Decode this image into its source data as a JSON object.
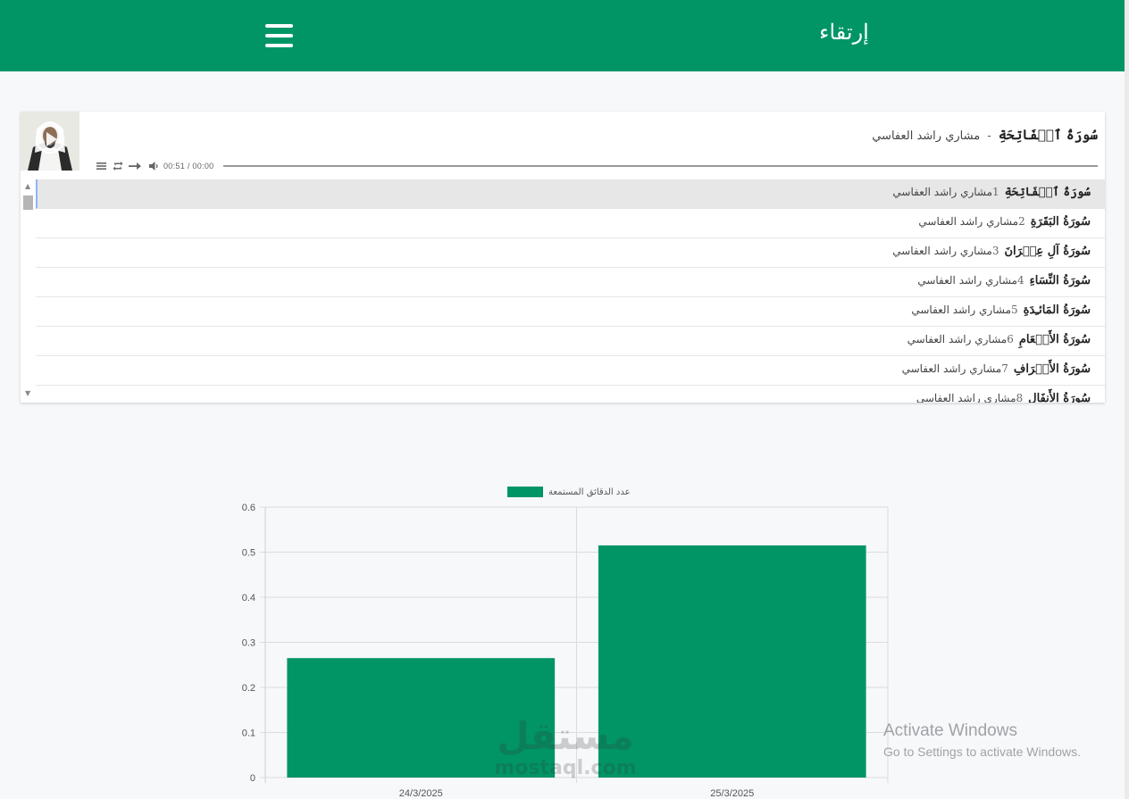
{
  "navbar": {
    "brand": "إرتقاء",
    "menu_icon": "hamburger-menu-icon",
    "background": "#019566"
  },
  "player": {
    "poster_icon": "play-circle-icon",
    "now_playing_title": "سُورَةُ ٱلۡفَاتِحَةِ",
    "now_playing_separator": "-",
    "now_playing_artist": "مشاري راشد العفاسي",
    "controls": [
      "playlist-icon",
      "repeat-icon",
      "next-arrow-icon",
      "volume-icon"
    ],
    "time": "00:51 / 00:00"
  },
  "playlist": [
    {
      "num": "1",
      "title": "سُورَةُ ٱلۡفَاتِحَةِ",
      "artist": "مشاري راشد العفاسي",
      "active": true
    },
    {
      "num": "2",
      "title": "سُورَةُ البَقَرَةِ",
      "artist": "مشاري راشد العفاسي"
    },
    {
      "num": "3",
      "title": "سُورَةُ آلِ عِمۡرَانَ",
      "artist": "مشاري راشد العفاسي"
    },
    {
      "num": "4",
      "title": "سُورَةُ النِّسَاءِ",
      "artist": "مشاري راشد العفاسي"
    },
    {
      "num": "5",
      "title": "سُورَةُ المَائـِدَةِ",
      "artist": "مشاري راشد العفاسي"
    },
    {
      "num": "6",
      "title": "سُورَةُ الأَنۡعَامِ",
      "artist": "مشاري راشد العفاسي"
    },
    {
      "num": "7",
      "title": "سُورَةُ الأَعۡرَافِ",
      "artist": "مشاري راشد العفاسي"
    },
    {
      "num": "8",
      "title": "سُورَةُ الأَنفَالِ",
      "artist": "مشاري راشد العفاسي"
    }
  ],
  "chart_data": {
    "type": "bar",
    "categories": [
      "24/3/2025",
      "25/3/2025"
    ],
    "series": [
      {
        "name": "عدد الدقائق المستمعة",
        "values": [
          0.265,
          0.515
        ],
        "color": "#019566"
      }
    ],
    "ylim": [
      0,
      0.6
    ],
    "yticks": [
      "0",
      "0.1",
      "0.2",
      "0.3",
      "0.4",
      "0.5",
      "0.6"
    ],
    "grid": true,
    "legend_position": "top-center"
  },
  "watermark": {
    "arabic": "مستقل",
    "latin": "mostaql.com"
  },
  "os_notice": {
    "line1": "Activate Windows",
    "line2": "Go to Settings to activate Windows."
  }
}
